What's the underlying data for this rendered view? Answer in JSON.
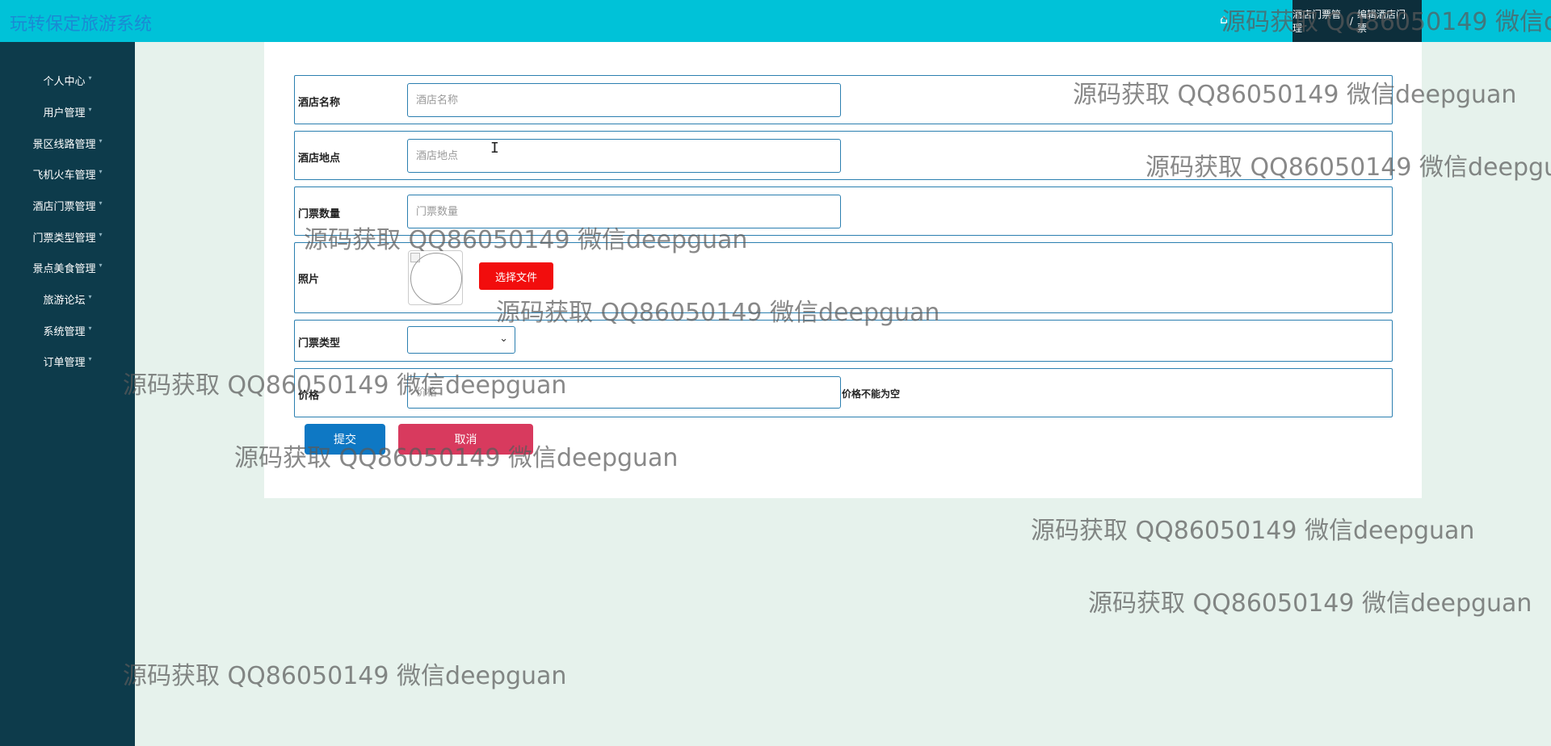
{
  "header": {
    "app_title": "玩转保定旅游系统",
    "home_icon": "home-icon",
    "breadcrumb": [
      "酒店门票管理",
      "编辑酒店门票"
    ],
    "breadcrumb_separator": "/"
  },
  "sidebar": {
    "items": [
      {
        "label": "个人中心"
      },
      {
        "label": "用户管理"
      },
      {
        "label": "景区线路管理"
      },
      {
        "label": "飞机火车管理"
      },
      {
        "label": "酒店门票管理"
      },
      {
        "label": "门票类型管理"
      },
      {
        "label": "景点美食管理"
      },
      {
        "label": "旅游论坛"
      },
      {
        "label": "系统管理"
      },
      {
        "label": "订单管理"
      }
    ]
  },
  "form": {
    "hotel_name": {
      "label": "酒店名称",
      "placeholder": "酒店名称",
      "value": ""
    },
    "hotel_location": {
      "label": "酒店地点",
      "placeholder": "酒店地点",
      "value": ""
    },
    "ticket_count": {
      "label": "门票数量",
      "placeholder": "门票数量",
      "value": ""
    },
    "photo": {
      "label": "照片",
      "choose_file_label": "选择文件"
    },
    "ticket_type": {
      "label": "门票类型",
      "selected": ""
    },
    "price": {
      "label": "价格",
      "placeholder": "价格",
      "value": "",
      "error": "价格不能为空"
    },
    "submit_label": "提交",
    "cancel_label": "取消"
  },
  "watermark_text": "源码获取 QQ86050149 微信deepguan",
  "colors": {
    "topbar": "#00c2d8",
    "sidebar": "#0d3b4b",
    "page_bg": "#e6f2ec",
    "submit": "#0e78c4",
    "cancel": "#d83a5e",
    "file_button": "#f20d0d"
  }
}
